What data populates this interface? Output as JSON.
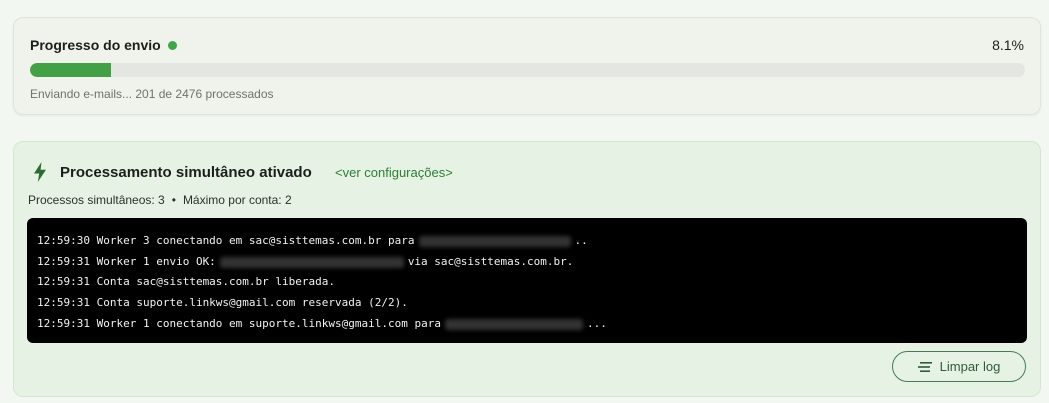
{
  "progress": {
    "title": "Progresso do envio",
    "percent_label": "8.1%",
    "percent_value": 8.1,
    "status_text": "Enviando e-mails... 201 de 2476 processados",
    "status_dot_color": "#3fa64a",
    "bar_color": "#43a047"
  },
  "processing": {
    "icon": "lightning-bolt-icon",
    "title": "Processamento simultâneo ativado",
    "config_link": "<ver configurações>",
    "info": {
      "simultaneous": "Processos simultâneos: 3",
      "separator": "•",
      "max_per_account": "Máximo por conta: 2"
    },
    "log": [
      {
        "a": "12:59:30 Worker 3 conectando em sac@sisttemas.com.br para",
        "b": ".."
      },
      {
        "a": "12:59:31 Worker 1 envio OK:",
        "b": "via sac@sisttemas.com.br."
      },
      {
        "a": "12:59:31 Conta sac@sisttemas.com.br liberada.",
        "b": ""
      },
      {
        "a": "12:59:31 Conta suporte.linkws@gmail.com reservada (2/2).",
        "b": ""
      },
      {
        "a": "12:59:31 Worker 1 conectando em suporte.linkws@gmail.com para",
        "b": "..."
      }
    ],
    "clear_button": "Limpar log"
  }
}
